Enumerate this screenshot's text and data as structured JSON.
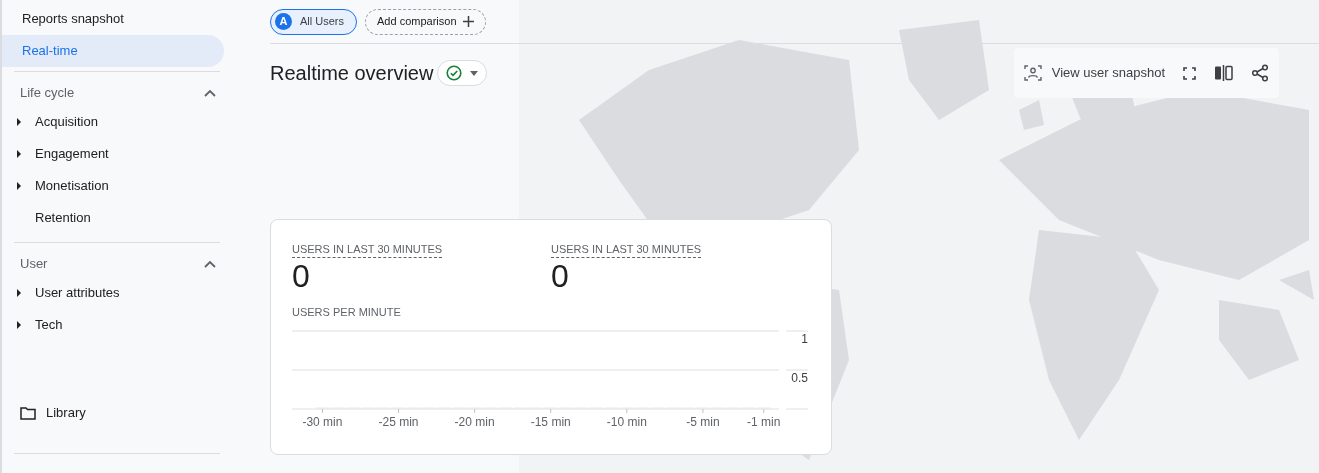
{
  "sidebar": {
    "items": [
      {
        "label": "Reports snapshot",
        "selected": false
      },
      {
        "label": "Real-time",
        "selected": true
      }
    ],
    "sections": [
      {
        "title": "Life cycle",
        "expanded": true,
        "items": [
          {
            "label": "Acquisition",
            "expandable": true
          },
          {
            "label": "Engagement",
            "expandable": true
          },
          {
            "label": "Monetisation",
            "expandable": true
          },
          {
            "label": "Retention",
            "expandable": false
          }
        ]
      },
      {
        "title": "User",
        "expanded": true,
        "items": [
          {
            "label": "User attributes",
            "expandable": true
          },
          {
            "label": "Tech",
            "expandable": true
          }
        ]
      }
    ],
    "library": "Library"
  },
  "comparison": {
    "segment_letter": "A",
    "segment": "All Users",
    "add": "Add comparison"
  },
  "title": "Realtime overview",
  "toolbar": {
    "snapshot": "View user snapshot"
  },
  "card": {
    "metrics": [
      {
        "label": "USERS IN LAST 30 MINUTES",
        "value": "0"
      },
      {
        "label": "USERS IN LAST 30 MINUTES",
        "value": "0"
      }
    ],
    "chart_data": {
      "type": "bar",
      "title": "USERS PER MINUTE",
      "x": [
        -30,
        -29,
        -28,
        -27,
        -26,
        -25,
        -24,
        -23,
        -22,
        -21,
        -20,
        -19,
        -18,
        -17,
        -16,
        -15,
        -14,
        -13,
        -12,
        -11,
        -10,
        -9,
        -8,
        -7,
        -6,
        -5,
        -4,
        -3,
        -2,
        -1
      ],
      "values": [
        0,
        0,
        0,
        0,
        0,
        0,
        0,
        0,
        0,
        0,
        0,
        0,
        0,
        0,
        0,
        0,
        0,
        0,
        0,
        0,
        0,
        0,
        0,
        0,
        0,
        0,
        0,
        0,
        0,
        0
      ],
      "xlim": [
        -32,
        0
      ],
      "ylim": [
        0,
        1
      ],
      "xticks": [
        {
          "value": -30,
          "label": "-30 min"
        },
        {
          "value": -25,
          "label": "-25 min"
        },
        {
          "value": -20,
          "label": "-20 min"
        },
        {
          "value": -15,
          "label": "-15 min"
        },
        {
          "value": -10,
          "label": "-10 min"
        },
        {
          "value": -5,
          "label": "-5 min"
        },
        {
          "value": -1,
          "label": "-1 min"
        }
      ],
      "yticks": [
        {
          "value": 0.5,
          "label": "0.5"
        },
        {
          "value": 1,
          "label": "1"
        }
      ]
    }
  }
}
